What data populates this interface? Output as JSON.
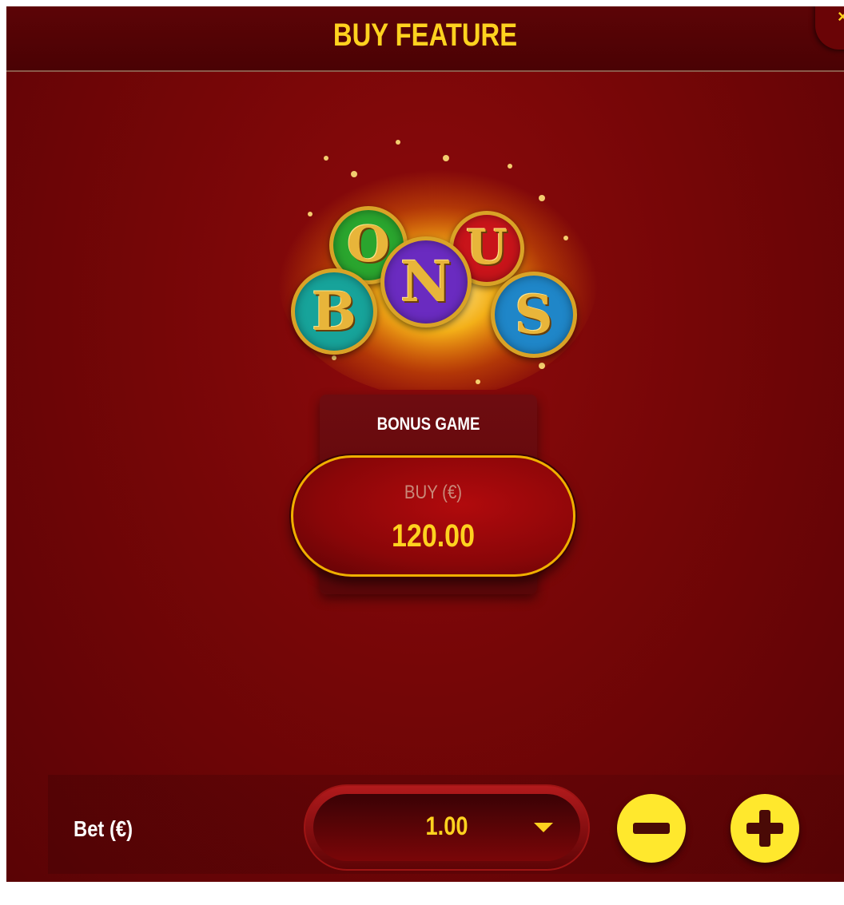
{
  "header": {
    "title": "BUY FEATURE",
    "close_glyph": "×"
  },
  "logo": {
    "letters": [
      "B",
      "O",
      "N",
      "U",
      "S"
    ],
    "coin_colors": [
      "#17a39a",
      "#2aa52e",
      "#6a2bc0",
      "#c8141a",
      "#1f86c8"
    ]
  },
  "feature": {
    "name": "BONUS GAME",
    "buy_label": "BUY (€)",
    "price": "120.00"
  },
  "bet": {
    "label": "Bet (€)",
    "value": "1.00"
  },
  "icons": {
    "close": "close-icon",
    "dropdown": "chevron-down-icon",
    "decrease": "minus-icon",
    "increase": "plus-icon"
  },
  "colors": {
    "accent": "#ffd21f",
    "panel": "#7a0608",
    "button": "#ffe82d"
  }
}
